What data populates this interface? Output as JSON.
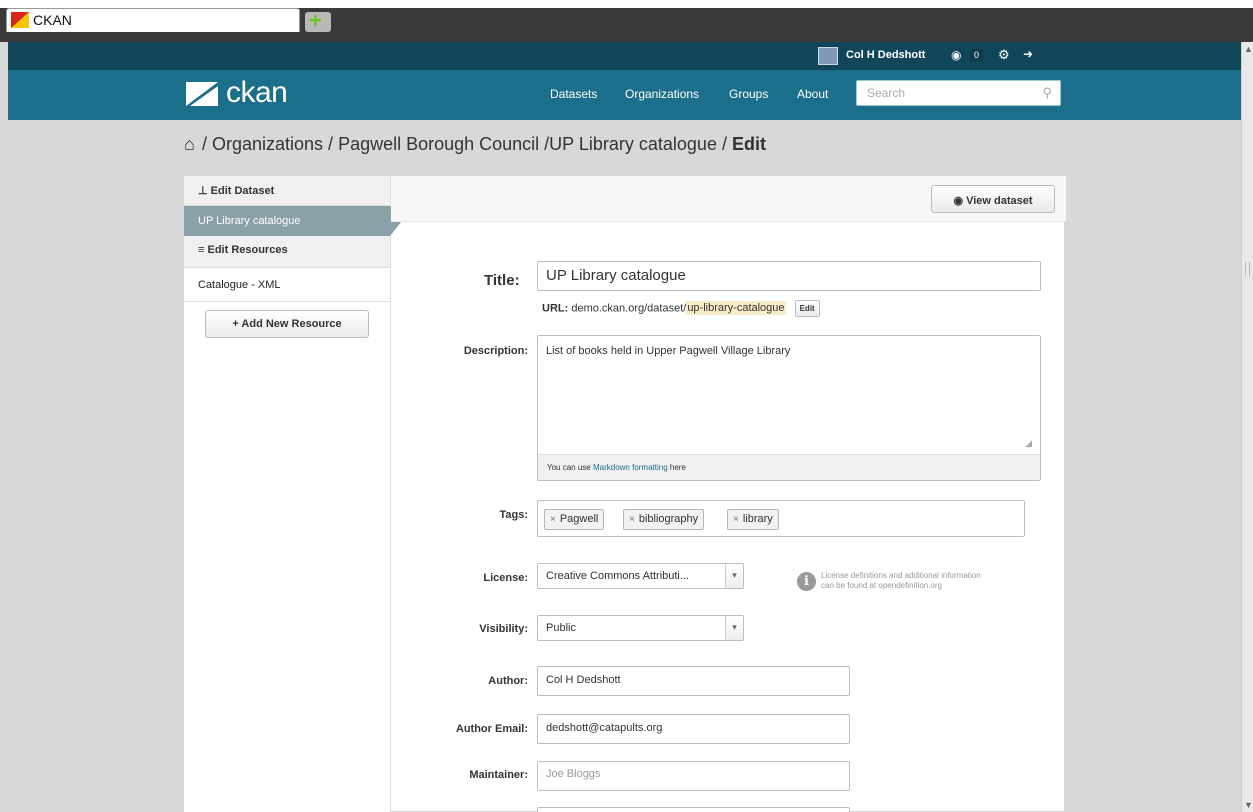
{
  "browser": {
    "tab_title": "CKAN",
    "new_tab_icon": "plus-icon"
  },
  "account": {
    "user_name": "Col H Dedshott",
    "dashboard_count": "0",
    "icons": [
      "avatar-icon",
      "dashboard-icon",
      "gear-icon",
      "sign-out-icon"
    ]
  },
  "masthead": {
    "logo_text": "ckan",
    "nav": [
      "Datasets",
      "Organizations",
      "Groups",
      "About"
    ],
    "search_placeholder": "Search"
  },
  "breadcrumb": {
    "path": "/ Organizations / Pagwell Borough Council /UP Library catalogue / ",
    "current": "Edit"
  },
  "sidebar": {
    "edit_dataset": "Edit Dataset",
    "active_item": "UP Library catalogue",
    "edit_resources": "Edit Resources",
    "resource_item": "Catalogue - XML",
    "add_resource": "Add New Resource"
  },
  "content": {
    "view_dataset": "View dataset",
    "title_label": "Title:",
    "title_value": "UP Library catalogue",
    "url_label": "URL:",
    "url_base": "demo.ckan.org/dataset/",
    "url_slug": "up-library-catalogue",
    "url_edit": "Edit",
    "description_label": "Description:",
    "description_value": "List of books held in Upper Pagwell Village Library",
    "markdown_pre": "You can use ",
    "markdown_link": "Markdown formatting",
    "markdown_post": " here",
    "tags_label": "Tags:",
    "tags": [
      "Pagwell",
      "bibliography",
      "library"
    ],
    "license_label": "License:",
    "license_value": "Creative Commons Attributi...",
    "license_info_line1": "License definitions and additional information",
    "license_info_pre": "can be found at ",
    "license_info_link": "opendefinition.org",
    "visibility_label": "Visibility:",
    "visibility_value": "Public",
    "author_label": "Author:",
    "author_value": "Col H Dedshott",
    "author_email_label": "Author Email:",
    "author_email_value": "dedshott@catapults.org",
    "maintainer_label": "Maintainer:",
    "maintainer_placeholder": "Joe Bloggs"
  },
  "colors": {
    "account_bar": "#11465a",
    "masthead": "#1b6f8a",
    "sidebar_active": "#8aa1a9"
  }
}
